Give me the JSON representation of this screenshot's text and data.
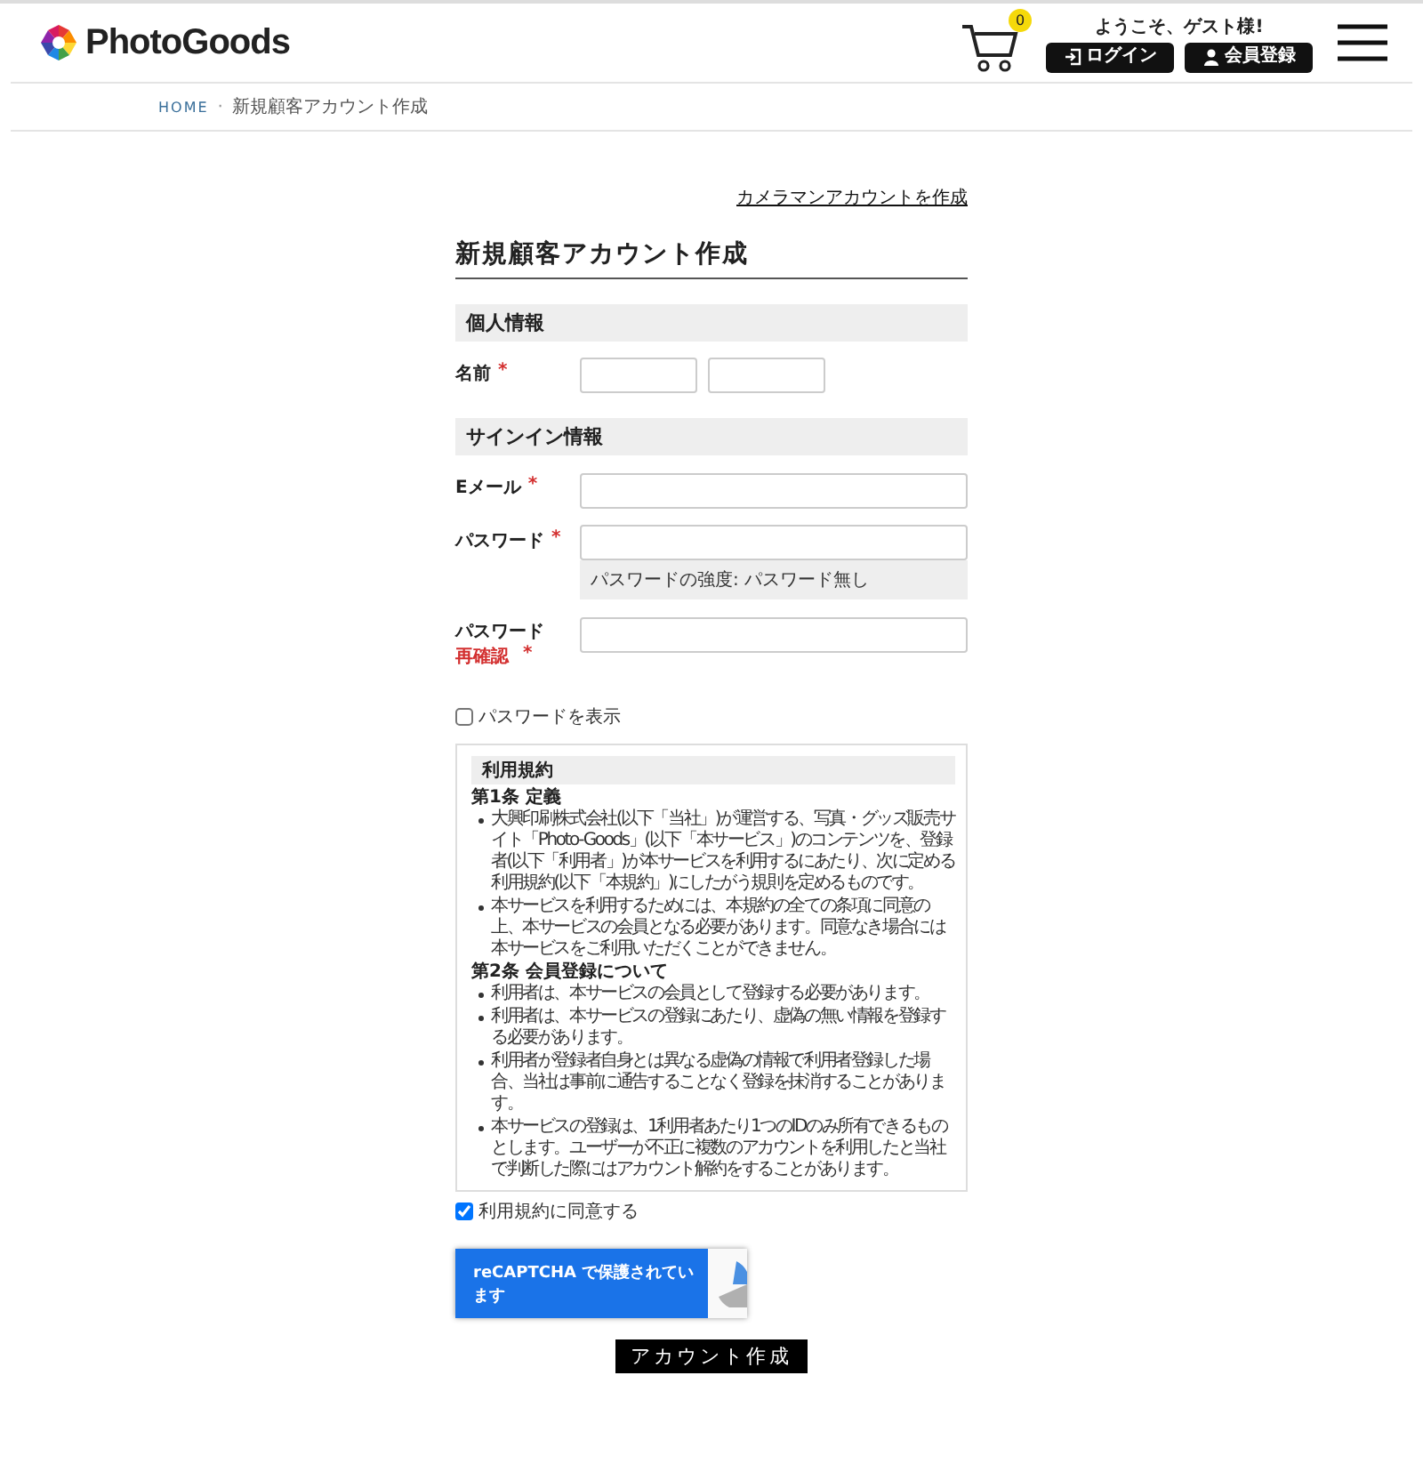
{
  "header": {
    "logo": "PhotoGoods",
    "cart_count": "0",
    "greeting": "ようこそ、ゲスト様!",
    "buttons": [
      {
        "kind": "login",
        "label": "ログイン"
      },
      {
        "kind": "register",
        "label": "会員登録"
      }
    ]
  },
  "breadcrumb_separator": "·",
  "breadcrumb": [
    {
      "label": "HOME",
      "link": true
    },
    {
      "label": "新規顧客アカウント作成",
      "link": false
    }
  ],
  "photographer_link": "カメラマンアカウントを作成",
  "title": "新規顧客アカウント作成",
  "sections": [
    {
      "heading": "個人情報",
      "fields": [
        {
          "kind": "name",
          "label": "名前",
          "required": "*"
        }
      ]
    },
    {
      "heading": "サインイン情報",
      "fields": [
        {
          "kind": "text",
          "label": "Eメール",
          "required": "*"
        },
        {
          "kind": "password",
          "label": "パスワード",
          "required": "*",
          "strength": "パスワードの強度: パスワード無し"
        },
        {
          "kind": "confirm",
          "label": "パスワード",
          "sublabel": "再確認",
          "required": "*"
        }
      ]
    }
  ],
  "show_password": {
    "label": "パスワードを表示",
    "checked": false
  },
  "terms": {
    "heading": "利用規約",
    "articles": [
      {
        "title": "第1条 定義",
        "items": [
          "大興印刷株式会社(以下「当社」)が運営する、写真・グッズ販売サイト「Photo-Goods」(以下「本サービス」)のコンテンツを、登録者(以下「利用者」)が本サービスを利用するにあたり、次に定める利用規約(以下「本規約」)にしたがう規則を定めるものです。",
          "本サービスを利用するためには、本規約の全ての条項に同意の上、本サービスの会員となる必要があります。同意なき場合には本サービスをご利用いただくことができません。"
        ]
      },
      {
        "title": "第2条 会員登録について",
        "items": [
          "利用者は、本サービスの会員として登録する必要があります。",
          "利用者は、本サービスの登録にあたり、虚偽の無い情報を登録する必要があります。",
          "利用者が登録者自身とは異なる虚偽の情報で利用者登録した場合、当社は事前に通告することなく登録を抹消することがあります。",
          "本サービスの登録は、1利用者あたり1つのIDのみ所有できるものとします。ユーザーが不正に複数のアカウントを利用したと当社で判断した際にはアカウント解約をすることがあります。"
        ]
      }
    ]
  },
  "agree": {
    "label": "利用規約に同意する",
    "checked": true
  },
  "recaptcha": "reCAPTCHA で保護されています",
  "submit": "アカウント作成"
}
